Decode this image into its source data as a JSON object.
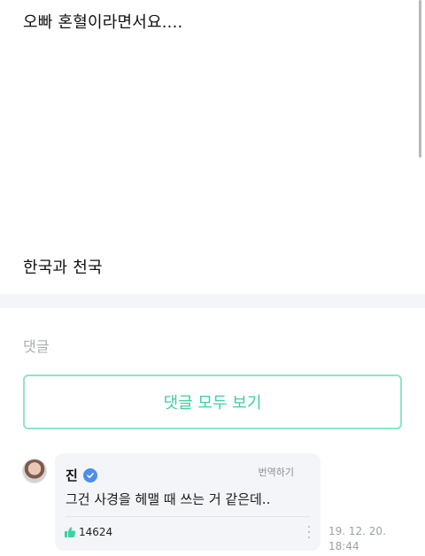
{
  "post": {
    "line1": "오빠 혼혈이라면서요....",
    "line2": "한국과 천국"
  },
  "comments": {
    "section_label": "댓글",
    "view_all_label": "댓글 모두 보기",
    "items": [
      {
        "author": "진",
        "verified": true,
        "translate_label": "번역하기",
        "text": "그건 사경을 헤맬 때 쓰는 거 같은데..",
        "likes": "14624",
        "date": "19. 12. 20.",
        "time": "18:44"
      }
    ]
  },
  "colors": {
    "accent": "#3ccfa4",
    "accent_border": "#8ee3c9",
    "verified": "#4a8ff0",
    "bubble_bg": "#f4f5f8"
  },
  "icons": {
    "verified": "verified-badge-icon",
    "like": "thumbs-up-icon",
    "more": "more-vertical-icon"
  }
}
